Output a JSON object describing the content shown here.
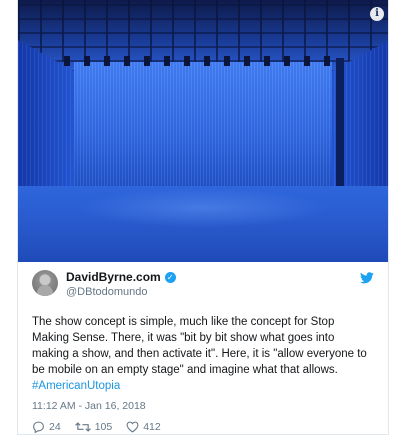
{
  "tweet": {
    "author": {
      "display_name": "DavidByrne.com",
      "handle": "@DBtodomundo",
      "verified": true
    },
    "text": "The show concept is simple, much like the concept for Stop Making Sense. There, it was \"bit by bit show what goes into making a show, and then activate it\". Here, it is \"allow everyone to be mobile on an empty stage\" and imagine what that allows.",
    "hashtag": "#AmericanUtopia",
    "timestamp": "11:12 AM - Jan 16, 2018",
    "stats": {
      "replies": "24",
      "retweets": "105",
      "likes": "412"
    }
  },
  "media": {
    "info_icon": "info-icon"
  },
  "colors": {
    "link": "#1b95e0",
    "verified": "#1da1f2",
    "secondary_text": "#657786"
  }
}
